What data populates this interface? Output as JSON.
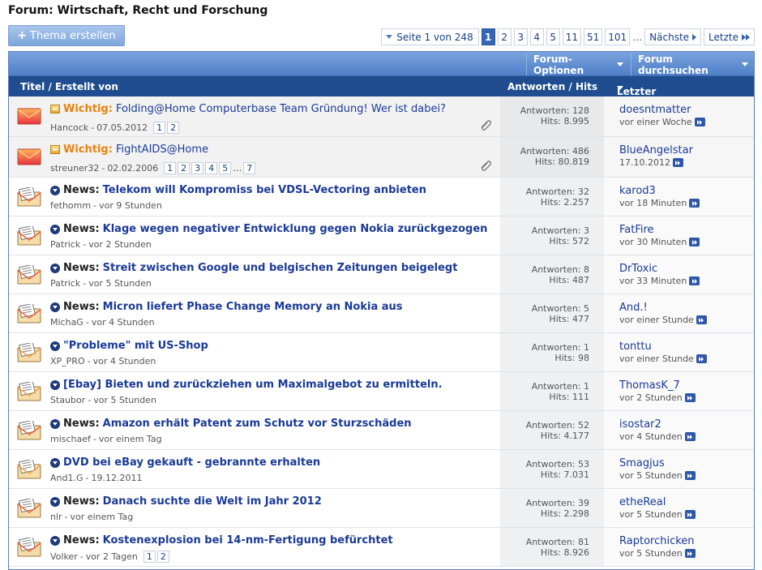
{
  "page": {
    "title": "Forum: Wirtschaft, Recht und Forschung",
    "new_thread_label": "Thema erstellen"
  },
  "pagination": {
    "page_of": "Seite 1 von 248",
    "pages": [
      "1",
      "2",
      "3",
      "4",
      "5",
      "11",
      "51",
      "101"
    ],
    "active": "1",
    "ellipsis": "…",
    "next_label": "Nächste",
    "last_label": "Letzte"
  },
  "toolbar": {
    "options_label": "Forum-Optionen",
    "search_label": "Forum durchsuchen"
  },
  "columns": {
    "title": "Titel / Erstellt von",
    "replies": "Antworten / Hits",
    "last_post": "Letzter Beitrag von"
  },
  "labels": {
    "replies_prefix": "Antworten:",
    "hits_prefix": "Hits:"
  },
  "threads": [
    {
      "type": "sticky",
      "prefix": "Wichtig:",
      "title": "Folding@Home Computerbase Team Gründung! Wer ist dabei?",
      "author": "Hancock",
      "date": "07.05.2012",
      "pages": [
        "1",
        "2"
      ],
      "replies": "Antworten: 128",
      "hits": "Hits: 8.995",
      "last_user": "doesntmatter",
      "last_time": "vor einer Woche",
      "attachment": true
    },
    {
      "type": "sticky",
      "prefix": "Wichtig:",
      "title": "FightAIDS@Home",
      "author": "streuner32",
      "date": "02.02.2006",
      "pages": [
        "1",
        "2",
        "3",
        "4",
        "5",
        "7"
      ],
      "replies": "Antworten: 486",
      "hits": "Hits: 80.819",
      "last_user": "BlueAngelstar",
      "last_time": "17.10.2012",
      "attachment": true
    },
    {
      "type": "news",
      "prefix": "News:",
      "title": "Telekom will Kompromiss bei VDSL-Vectoring anbieten",
      "author": "fethomm",
      "date": "vor 9 Stunden",
      "pages": [],
      "replies": "Antworten: 32",
      "hits": "Hits: 2.257",
      "last_user": "karod3",
      "last_time": "vor 18 Minuten"
    },
    {
      "type": "news",
      "prefix": "News:",
      "title": "Klage wegen negativer Entwicklung gegen Nokia zurückgezogen",
      "author": "Patrick",
      "date": "vor 2 Stunden",
      "pages": [],
      "replies": "Antworten: 3",
      "hits": "Hits: 572",
      "last_user": "FatFire",
      "last_time": "vor 30 Minuten"
    },
    {
      "type": "news",
      "prefix": "News:",
      "title": "Streit zwischen Google und belgischen Zeitungen beigelegt",
      "author": "Patrick",
      "date": "vor 5 Stunden",
      "pages": [],
      "replies": "Antworten: 8",
      "hits": "Hits: 487",
      "last_user": "DrToxic",
      "last_time": "vor 33 Minuten"
    },
    {
      "type": "news",
      "prefix": "News:",
      "title": "Micron liefert Phase Change Memory an Nokia aus",
      "author": "MichaG",
      "date": "vor 4 Stunden",
      "pages": [],
      "replies": "Antworten: 5",
      "hits": "Hits: 477",
      "last_user": "And.!",
      "last_time": "vor einer Stunde"
    },
    {
      "type": "normal",
      "prefix": "",
      "title": "\"Probleme\" mit US-Shop",
      "author": "XP_PRO",
      "date": "vor 4 Stunden",
      "pages": [],
      "replies": "Antworten: 1",
      "hits": "Hits: 98",
      "last_user": "tonttu",
      "last_time": "vor einer Stunde"
    },
    {
      "type": "normal",
      "prefix": "",
      "title": "[Ebay] Bieten und zurückziehen um Maximalgebot zu ermitteln.",
      "author": "Staubor",
      "date": "vor 5 Stunden",
      "pages": [],
      "replies": "Antworten: 1",
      "hits": "Hits: 111",
      "last_user": "ThomasK_7",
      "last_time": "vor 2 Stunden"
    },
    {
      "type": "news",
      "prefix": "News:",
      "title": "Amazon erhält Patent zum Schutz vor Sturzschäden",
      "author": "mischaef",
      "date": "vor einem Tag",
      "pages": [],
      "replies": "Antworten: 52",
      "hits": "Hits: 4.177",
      "last_user": "isostar2",
      "last_time": "vor 4 Stunden"
    },
    {
      "type": "normal",
      "prefix": "",
      "title": "DVD bei eBay gekauft - gebrannte erhalten",
      "author": "And1.G",
      "date": "19.12.2011",
      "pages": [],
      "replies": "Antworten: 53",
      "hits": "Hits: 7.031",
      "last_user": "Smagjus",
      "last_time": "vor 5 Stunden"
    },
    {
      "type": "news",
      "prefix": "News:",
      "title": "Danach suchte die Welt im Jahr 2012",
      "author": "nlr",
      "date": "vor einem Tag",
      "pages": [],
      "replies": "Antworten: 39",
      "hits": "Hits: 2.298",
      "last_user": "etheReal",
      "last_time": "vor 5 Stunden"
    },
    {
      "type": "news",
      "prefix": "News:",
      "title": "Kostenexplosion bei 14-nm-Fertigung befürchtet",
      "author": "Volker",
      "date": "vor 2 Tagen",
      "pages": [
        "1",
        "2"
      ],
      "replies": "Antworten: 81",
      "hits": "Hits: 8.926",
      "last_user": "Raptorchicken",
      "last_time": "vor 5 Stunden"
    }
  ],
  "colors": {
    "accent": "#3566b5",
    "header_dark": "#1f4d8f",
    "link": "#1b3a96",
    "important": "#e8830c"
  }
}
